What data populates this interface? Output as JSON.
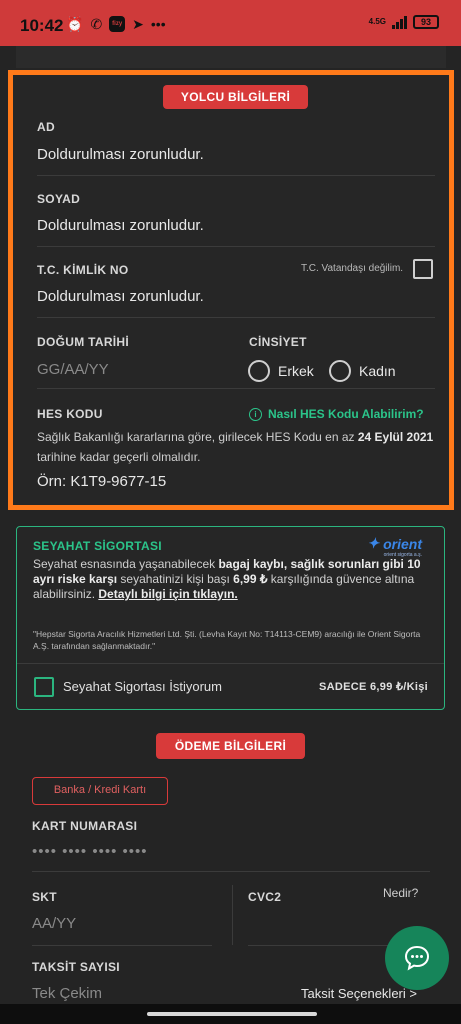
{
  "status_bar": {
    "time": "10:42",
    "fizy": "fizy",
    "network": "4.5G",
    "battery": "93",
    "bg_color": "#cf3a3a"
  },
  "passenger_section": {
    "badge": "YOLCU BİLGİLERİ",
    "border_color": "#ff7a1a",
    "ad_label": "AD",
    "ad_value": "Doldurulması zorunludur.",
    "soyad_label": "SOYAD",
    "soyad_value": "Doldurulması zorunludur.",
    "tc_label": "T.C. KİMLİK NO",
    "tc_value": "Doldurulması zorunludur.",
    "not_citizen_label": "T.C. Vatandaşı değilim.",
    "dob_label": "DOĞUM TARİHİ",
    "dob_placeholder": "GG/AA/YY",
    "gender_label": "CİNSİYET",
    "gender_options": [
      "Erkek",
      "Kadın"
    ],
    "hes_label": "HES KODU",
    "hes_link": "Nasıl HES Kodu Alabilirim?",
    "hes_desc_1": "Sağlık Bakanlığı kararlarına göre, girilecek HES Kodu en az ",
    "hes_desc_bold": "24 Eylül 2021",
    "hes_desc_2": " tarihine kadar geçerli olmalıdır.",
    "hes_placeholder": "Örn: K1T9-9677-15"
  },
  "insurance": {
    "title": "SEYAHAT SİGORTASI",
    "logo_name": "orient",
    "logo_sub": "orient sigorta a.ş.",
    "text_1": "Seyahat esnasında yaşanabilecek ",
    "text_b1": "bagaj kaybı, sağlık sorunları gibi 10 ayrı riske karşı",
    "text_2": " seyahatinizi kişi başı ",
    "text_b2": "6,99 ₺",
    "text_3": " karşılığında güvence altına alabilirsiniz. ",
    "text_link": "Detaylı bilgi için tıklayın.",
    "note": "\"Hepstar Sigorta Aracılık Hizmetleri Ltd. Şti. (Levha Kayıt No: T14113-CEM9) aracılığı ile Orient Sigorta A.Ş. tarafından sağlanmaktadır.\"",
    "checkbox_label": "Seyahat Sigortası İstiyorum",
    "price": "SADECE 6,99 ₺/Kişi",
    "accent_color": "#2bc48a"
  },
  "payment": {
    "badge": "ÖDEME BİLGİLERİ",
    "tab": "Banka / Kredi Kartı",
    "card_label": "KART NUMARASI",
    "card_placeholder": "•••• •••• •••• ••••",
    "skt_label": "SKT",
    "skt_placeholder": "AA/YY",
    "cvc_label": "CVC2",
    "cvc_help": "Nedir?",
    "installment_label": "TAKSİT SAYISI",
    "installment_value": "Tek Çekim",
    "installment_options": "Taksit Seçenekleri >"
  },
  "chat": {
    "icon": "chat-bubble-icon",
    "color": "#16855a"
  }
}
